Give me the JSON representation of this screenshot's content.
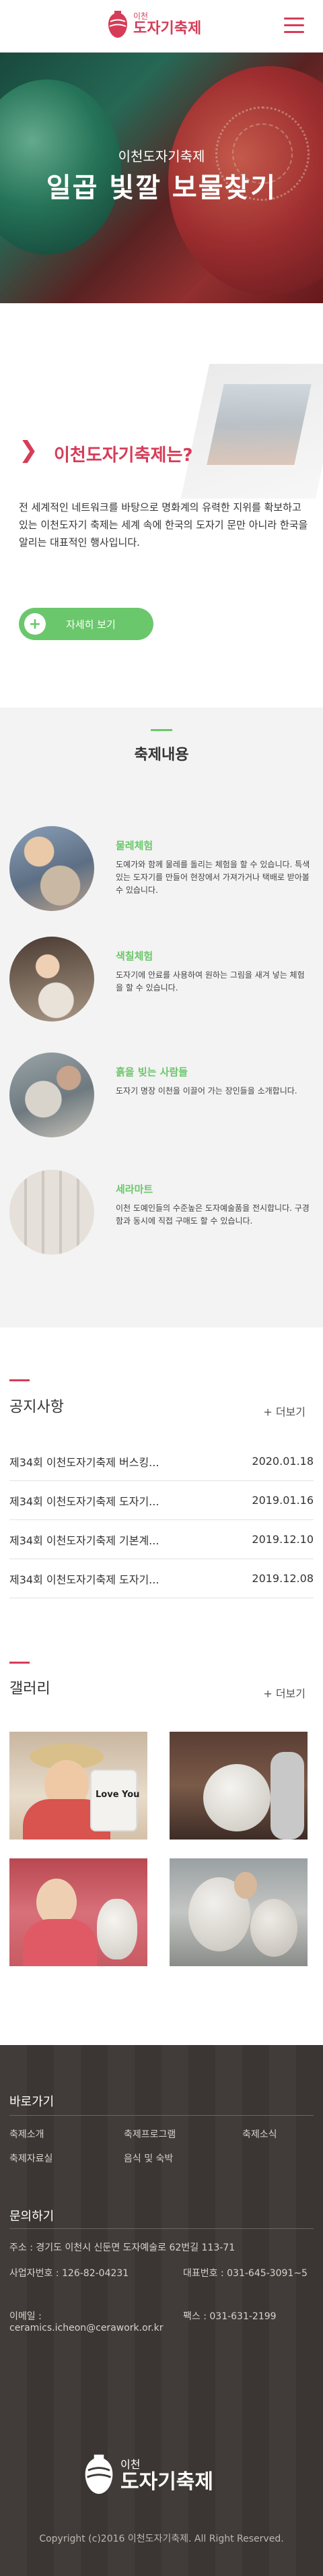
{
  "header": {
    "logo_small": "이천",
    "logo_big": "도자기축제",
    "menu_icon": "hamburger-icon"
  },
  "hero": {
    "subtitle": "이천도자기축제",
    "title": "일곱 빛깔 보물찾기"
  },
  "about": {
    "heading": "이천도자기축제는?",
    "description": "전 세계적인 네트워크를 바탕으로 명화계의 유력한 지위를 확보하고 있는 이천도자기 축제는 세계 속에 한국의 도자기 문만 아니라 한국을 알리는 대표적인 행사입니다.",
    "button_label": "자세히 보기"
  },
  "festival": {
    "title": "축제내용",
    "items": [
      {
        "name": "물레체험",
        "text": "도예가와 함께 물레를 돌리는 체험을 할 수 있습니다. 특색있는 도자기를 만들어 현장에서 가져가거나 택배로 받아볼 수 있습니다."
      },
      {
        "name": "색칠체험",
        "text": "도자기에 안료를 사용하여 원하는 그림을 새겨 넣는 체험을 할 수 있습니다."
      },
      {
        "name": "흙을 빚는 사람들",
        "text": "도자기 명장 이천을 이끌어 가는 장인들을 소개합니다."
      },
      {
        "name": "세라마트",
        "text": "이천 도예인들의 수준높은 도자예술품을 전시합니다. 구경함과 동시에 직접 구매도 할 수 있습니다."
      }
    ]
  },
  "notice": {
    "title": "공지사항",
    "more": "+ 더보기",
    "rows": [
      {
        "title": "제34회 이천도자기축제 버스킹...",
        "date": "2020.01.18"
      },
      {
        "title": "제34회 이천도자기축제 도자기...",
        "date": "2019.01.16"
      },
      {
        "title": "제34회 이천도자기축제 기본계...",
        "date": "2019.12.10"
      },
      {
        "title": "제34회 이천도자기축제 도자기...",
        "date": "2019.12.08"
      }
    ]
  },
  "gallery": {
    "title": "갤러리",
    "more": "+ 더보기",
    "mug_text": "Love You"
  },
  "footer": {
    "shortcut_title": "바로가기",
    "links": [
      "축제소개",
      "축제프로그램",
      "축제소식",
      "축제자료실",
      "음식 및 숙박"
    ],
    "contact_title": "문의하기",
    "address": "주소 : 경기도 이천시 신둔면 도자예술로 62번길 113-71",
    "business_no": "사업자번호 : 126-82-04231",
    "phone": "대표번호 : 031-645-3091~5",
    "email_label": "이메일 :",
    "email": "ceramics.icheon@cerawork.or.kr",
    "fax": "팩스 : 031-631-2199",
    "logo_small": "이천",
    "logo_big": "도자기축제",
    "copyright": "Copyright (c)2016 이천도자기축제. All Right Reserved."
  }
}
